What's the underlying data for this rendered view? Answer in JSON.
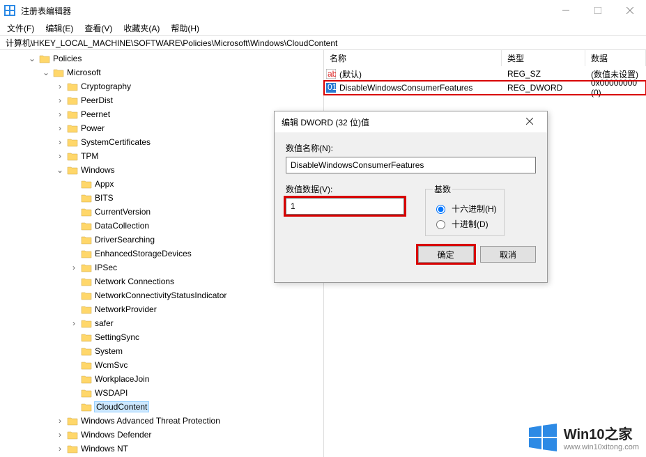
{
  "window": {
    "title": "注册表编辑器"
  },
  "menu": {
    "file": "文件(F)",
    "edit": "编辑(E)",
    "view": "查看(V)",
    "favorites": "收藏夹(A)",
    "help": "帮助(H)"
  },
  "address": "计算机\\HKEY_LOCAL_MACHINE\\SOFTWARE\\Policies\\Microsoft\\Windows\\CloudContent",
  "tree": {
    "policies": "Policies",
    "microsoft": "Microsoft",
    "ms_children": [
      "Cryptography",
      "PeerDist",
      "Peernet",
      "Power",
      "SystemCertificates",
      "TPM"
    ],
    "windows": "Windows",
    "win_children": [
      "Appx",
      "BITS",
      "CurrentVersion",
      "DataCollection",
      "DriverSearching",
      "EnhancedStorageDevices",
      "IPSec",
      "Network Connections",
      "NetworkConnectivityStatusIndicator",
      "NetworkProvider",
      "safer",
      "SettingSync",
      "System",
      "WcmSvc",
      "WorkplaceJoin",
      "WSDAPI",
      "CloudContent"
    ],
    "after_windows": [
      "Windows Advanced Threat Protection",
      "Windows Defender",
      "Windows NT"
    ]
  },
  "values": {
    "headers": {
      "name": "名称",
      "type": "类型",
      "data": "数据"
    },
    "rows": [
      {
        "name": "(默认)",
        "type": "REG_SZ",
        "data": "(数值未设置)",
        "icon": "ab"
      },
      {
        "name": "DisableWindowsConsumerFeatures",
        "type": "REG_DWORD",
        "data": "0x00000000 (0)",
        "icon": "dword"
      }
    ]
  },
  "dialog": {
    "title": "编辑 DWORD (32 位)值",
    "name_label": "数值名称(N):",
    "name_value": "DisableWindowsConsumerFeatures",
    "data_label": "数值数据(V):",
    "data_value": "1",
    "base_label": "基数",
    "hex": "十六进制(H)",
    "dec": "十进制(D)",
    "ok": "确定",
    "cancel": "取消"
  },
  "watermark": {
    "title": "Win10之家",
    "url": "www.win10xitong.com"
  }
}
